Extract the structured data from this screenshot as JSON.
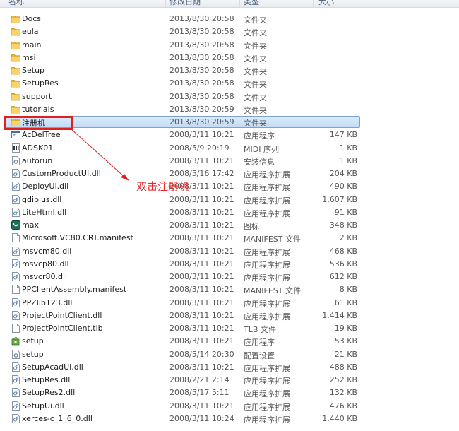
{
  "header": {
    "columns": [
      "名称",
      "修改日期",
      "类型",
      "大小"
    ]
  },
  "annotation": "双击注册机",
  "colors": {
    "selection_fill": "#cfe3fa",
    "selection_border": "#7da2ce",
    "annotation_red": "#e0201e",
    "folder_yellow": "#f2c94c"
  },
  "files": [
    {
      "name": "Docs",
      "date": "2013/8/30 20:58",
      "type": "文件夹",
      "size": "",
      "icon": "folder-icon"
    },
    {
      "name": "eula",
      "date": "2013/8/30 20:58",
      "type": "文件夹",
      "size": "",
      "icon": "folder-icon"
    },
    {
      "name": "main",
      "date": "2013/8/30 20:58",
      "type": "文件夹",
      "size": "",
      "icon": "folder-icon"
    },
    {
      "name": "msi",
      "date": "2013/8/30 20:58",
      "type": "文件夹",
      "size": "",
      "icon": "folder-icon"
    },
    {
      "name": "Setup",
      "date": "2013/8/30 20:58",
      "type": "文件夹",
      "size": "",
      "icon": "folder-icon"
    },
    {
      "name": "SetupRes",
      "date": "2013/8/30 20:58",
      "type": "文件夹",
      "size": "",
      "icon": "folder-icon"
    },
    {
      "name": "support",
      "date": "2013/8/30 20:58",
      "type": "文件夹",
      "size": "",
      "icon": "folder-icon"
    },
    {
      "name": "tutorials",
      "date": "2013/8/30 20:59",
      "type": "文件夹",
      "size": "",
      "icon": "folder-icon"
    },
    {
      "name": "注册机",
      "date": "2013/8/30 20:59",
      "type": "文件夹",
      "size": "",
      "icon": "folder-icon",
      "selected": true
    },
    {
      "name": "AcDelTree",
      "date": "2008/3/11 10:21",
      "type": "应用程序",
      "size": "147 KB",
      "icon": "app-icon"
    },
    {
      "name": "ADSK01",
      "date": "2008/5/9 20:19",
      "type": "MIDI 序列",
      "size": "1 KB",
      "icon": "midi-icon"
    },
    {
      "name": "autorun",
      "date": "2008/3/11 10:21",
      "type": "安装信息",
      "size": "1 KB",
      "icon": "settings-file-icon"
    },
    {
      "name": "CustomProductUI.dll",
      "date": "2008/5/16 17:42",
      "type": "应用程序扩展",
      "size": "204 KB",
      "icon": "dll-icon"
    },
    {
      "name": "DeployUi.dll",
      "date": "2008/3/11 10:21",
      "type": "应用程序扩展",
      "size": "490 KB",
      "icon": "dll-icon"
    },
    {
      "name": "gdiplus.dll",
      "date": "2008/3/11 10:21",
      "type": "应用程序扩展",
      "size": "1,607 KB",
      "icon": "dll-icon"
    },
    {
      "name": "LiteHtml.dll",
      "date": "2008/3/11 10:21",
      "type": "应用程序扩展",
      "size": "91 KB",
      "icon": "dll-icon"
    },
    {
      "name": "max",
      "date": "2008/3/11 10:21",
      "type": "图标",
      "size": "348 KB",
      "icon": "max-icon"
    },
    {
      "name": "Microsoft.VC80.CRT.manifest",
      "date": "2008/3/11 10:21",
      "type": "MANIFEST 文件",
      "size": "2 KB",
      "icon": "file-icon"
    },
    {
      "name": "msvcm80.dll",
      "date": "2008/3/11 10:21",
      "type": "应用程序扩展",
      "size": "468 KB",
      "icon": "dll-icon"
    },
    {
      "name": "msvcp80.dll",
      "date": "2008/3/11 10:21",
      "type": "应用程序扩展",
      "size": "536 KB",
      "icon": "dll-icon"
    },
    {
      "name": "msvcr80.dll",
      "date": "2008/3/11 10:21",
      "type": "应用程序扩展",
      "size": "612 KB",
      "icon": "dll-icon"
    },
    {
      "name": "PPClientAssembly.manifest",
      "date": "2008/3/11 10:21",
      "type": "MANIFEST 文件",
      "size": "8 KB",
      "icon": "file-icon"
    },
    {
      "name": "PPZlib123.dll",
      "date": "2008/3/11 10:21",
      "type": "应用程序扩展",
      "size": "61 KB",
      "icon": "dll-icon"
    },
    {
      "name": "ProjectPointClient.dll",
      "date": "2008/3/11 10:21",
      "type": "应用程序扩展",
      "size": "1,414 KB",
      "icon": "dll-icon"
    },
    {
      "name": "ProjectPointClient.tlb",
      "date": "2008/3/11 10:21",
      "type": "TLB 文件",
      "size": "19 KB",
      "icon": "file-icon"
    },
    {
      "name": "setup",
      "date": "2008/3/11 10:21",
      "type": "应用程序",
      "size": "53 KB",
      "icon": "setup-icon"
    },
    {
      "name": "setup",
      "date": "2008/5/14 20:30",
      "type": "配置设置",
      "size": "21 KB",
      "icon": "settings-file-icon"
    },
    {
      "name": "SetupAcadUi.dll",
      "date": "2008/3/11 10:21",
      "type": "应用程序扩展",
      "size": "488 KB",
      "icon": "dll-icon"
    },
    {
      "name": "SetupRes.dll",
      "date": "2008/2/21 2:14",
      "type": "应用程序扩展",
      "size": "252 KB",
      "icon": "dll-icon"
    },
    {
      "name": "SetupRes2.dll",
      "date": "2008/5/17 5:11",
      "type": "应用程序扩展",
      "size": "132 KB",
      "icon": "dll-icon"
    },
    {
      "name": "SetupUi.dll",
      "date": "2008/3/11 10:21",
      "type": "应用程序扩展",
      "size": "476 KB",
      "icon": "dll-icon"
    },
    {
      "name": "xerces-c_1_6_0.dll",
      "date": "2008/3/11 10:24",
      "type": "应用程序扩展",
      "size": "1,440 KB",
      "icon": "dll-icon"
    }
  ]
}
